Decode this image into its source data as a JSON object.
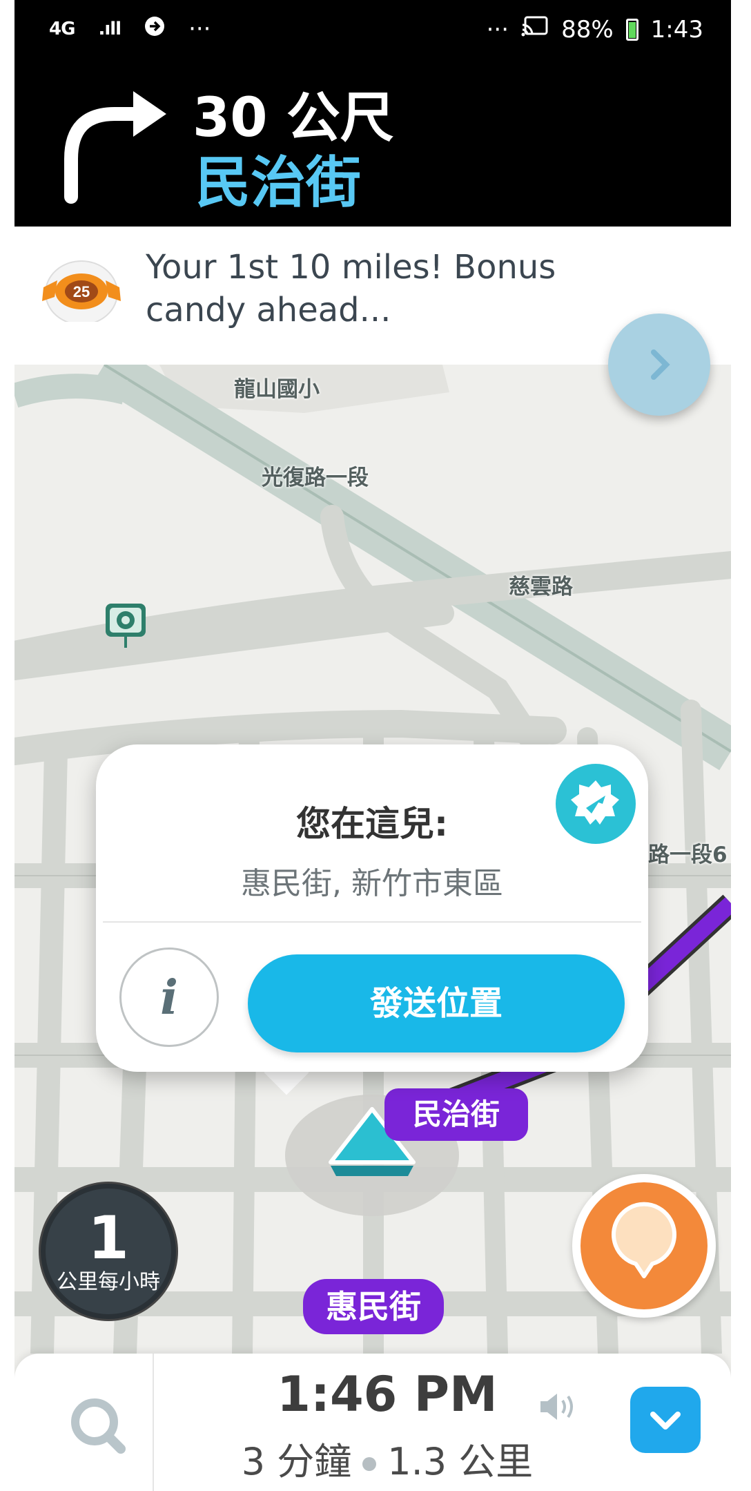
{
  "status_bar": {
    "network": "4G",
    "signal": ".ıll",
    "left_more": "···",
    "right_more": "···",
    "battery": "88%",
    "time": "1:43"
  },
  "navigation": {
    "turn": "turn-right-icon",
    "distance": "30 公尺",
    "street": "民治街"
  },
  "banner": {
    "text": "Your 1st 10 miles! Bonus candy ahead...",
    "candy_value": "25",
    "next_icon": "chevron-right-icon"
  },
  "map": {
    "labels": [
      "龍山國小",
      "光復路一段",
      "慈雲路",
      "路一段6"
    ],
    "route_color": "#7a25d8"
  },
  "popup": {
    "title": "您在這兒:",
    "address": "惠民街, 新竹市東區",
    "info_label": "i",
    "send_label": "發送位置"
  },
  "street_pills": {
    "route_street": "民治街",
    "current_street": "惠民街"
  },
  "speed": {
    "value": "1",
    "unit": "公里每小時"
  },
  "bottom": {
    "eta": "1:46 PM",
    "minutes": "3 分鐘",
    "distance": "1.3 公里"
  },
  "colors": {
    "accent": "#19b8e8",
    "route": "#7a25d8",
    "report": "#f3893a",
    "street_highlight": "#58c8f4"
  }
}
